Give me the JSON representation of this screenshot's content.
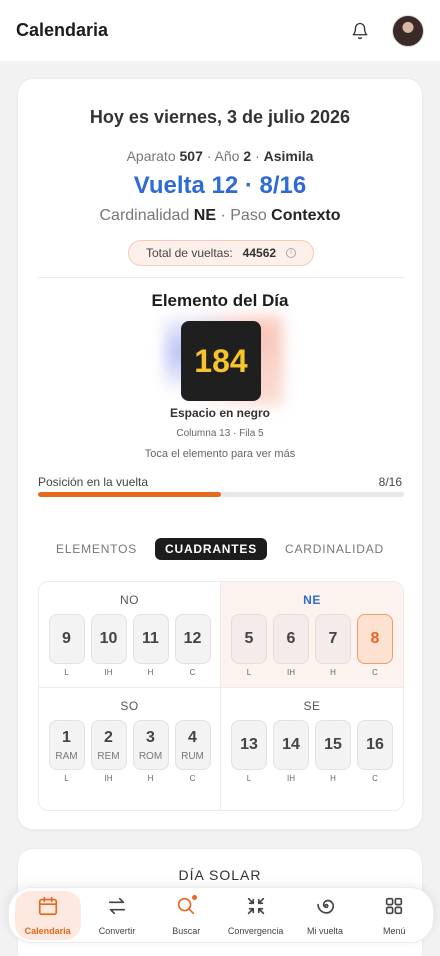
{
  "app": {
    "title": "Calendaria"
  },
  "today": {
    "date_heading": "Hoy es viernes, 3 de julio 2026",
    "aparato_label": "Aparato",
    "aparato_value": "507",
    "anio_label": "Año",
    "anio_value": "2",
    "phase": "Asimila",
    "vuelta": "Vuelta 12 · 8/16",
    "cardinalidad_label": "Cardinalidad",
    "cardinalidad_value": "NE",
    "paso_label": "Paso",
    "paso_value": "Contexto",
    "total_label": "Total de vueltas:",
    "total_value": "44562"
  },
  "element": {
    "heading": "Elemento del Día",
    "number": "184",
    "name": "Espacio en negro",
    "position": "Columna 13 · Fila 5",
    "hint": "Toca el elemento para ver más"
  },
  "progress": {
    "label": "Posición en la vuelta",
    "count": "8/16",
    "fraction": 0.5
  },
  "tabs": [
    {
      "label": "ELEMENTOS",
      "active": false
    },
    {
      "label": "CUADRANTES",
      "active": true
    },
    {
      "label": "CARDINALIDAD",
      "active": false
    }
  ],
  "quadrants": [
    {
      "title": "NO",
      "active": false,
      "cells": [
        {
          "num": "9",
          "sub": "",
          "label": "L"
        },
        {
          "num": "10",
          "sub": "",
          "label": "IH"
        },
        {
          "num": "11",
          "sub": "",
          "label": "H"
        },
        {
          "num": "12",
          "sub": "",
          "label": "C"
        }
      ]
    },
    {
      "title": "NE",
      "active": true,
      "cells": [
        {
          "num": "5",
          "sub": "",
          "label": "L"
        },
        {
          "num": "6",
          "sub": "",
          "label": "IH"
        },
        {
          "num": "7",
          "sub": "",
          "label": "H"
        },
        {
          "num": "8",
          "sub": "",
          "label": "C",
          "current": true
        }
      ]
    },
    {
      "title": "SO",
      "active": false,
      "cells": [
        {
          "num": "1",
          "sub": "RAM",
          "label": "L"
        },
        {
          "num": "2",
          "sub": "REM",
          "label": "IH"
        },
        {
          "num": "3",
          "sub": "ROM",
          "label": "H"
        },
        {
          "num": "4",
          "sub": "RUM",
          "label": "C"
        }
      ]
    },
    {
      "title": "SE",
      "active": false,
      "cells": [
        {
          "num": "13",
          "sub": "",
          "label": "L"
        },
        {
          "num": "14",
          "sub": "",
          "label": "IH"
        },
        {
          "num": "15",
          "sub": "",
          "label": "H"
        },
        {
          "num": "16",
          "sub": "",
          "label": "C"
        }
      ]
    }
  ],
  "solar": {
    "title": "DÍA SOLAR"
  },
  "nav": [
    {
      "label": "Calendaria",
      "icon": "calendar-icon",
      "active": true
    },
    {
      "label": "Convertir",
      "icon": "swap-icon",
      "active": false
    },
    {
      "label": "Buscar",
      "icon": "search-icon",
      "active": false,
      "badge": true
    },
    {
      "label": "Convergencia",
      "icon": "converge-icon",
      "active": false
    },
    {
      "label": "Mi vuelta",
      "icon": "spiral-icon",
      "active": false
    },
    {
      "label": "Menú",
      "icon": "grid-icon",
      "active": false
    }
  ],
  "colors": {
    "accent": "#e8661e",
    "blue": "#2f6bd6",
    "tile": "#1f1f1f",
    "tile_number": "#f7c52b"
  }
}
